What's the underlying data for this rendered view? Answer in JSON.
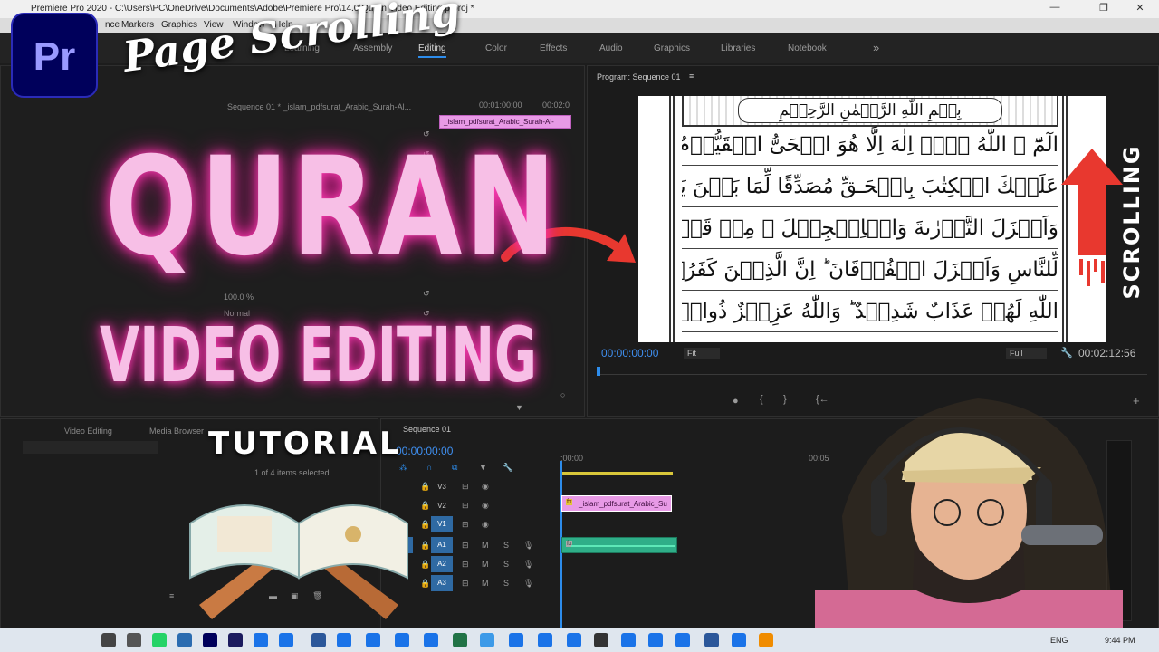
{
  "titlebar": {
    "title": "Premiere Pro 2020 - C:\\Users\\PC\\OneDrive\\Documents\\Adobe\\Premiere Pro\\14.0\\Quran Video Editing.prproj *",
    "minimize": "—",
    "maximize": "❐",
    "close": "✕"
  },
  "menubar": {
    "items": [
      "nce",
      "Markers",
      "Graphics",
      "View",
      "Window",
      "Help"
    ]
  },
  "workspaces": {
    "tabs": [
      "Learning",
      "Assembly",
      "Editing",
      "Color",
      "Effects",
      "Audio",
      "Graphics",
      "Libraries",
      "Notebook"
    ],
    "more": "»"
  },
  "source_panel": {
    "clip_name": "_islam_pdfsurat_Arabic_Surah-Al-",
    "sequence_label": "Sequence 01 * _islam_pdfsurat_Arabic_Surah-Al...",
    "time_1": "00:01:00:00",
    "time_2": "00:02:0",
    "opacity_value": "100.0 %",
    "blend_mode": "Normal"
  },
  "program": {
    "title": "Program: Sequence 01",
    "menu_icon": "≡",
    "current_time": "00:00:00:00",
    "fit": "Fit",
    "quality": "Full",
    "duration": "00:02:12:56"
  },
  "quran_page": {
    "header": "بِسۡمِ اللّٰهِ الرَّحۡمٰنِ الرَّحِيۡمِ",
    "lines": [
      "الٓمّٓ ۚ اللّٰهُ لَاۤ اِلٰهَ اِلَّا هُوَ الۡحَىُّ الۡقَيُّوۡمُ ؕ نَزَّلَ",
      "عَلَيۡكَ الۡكِتٰبَ بِالۡحَـقِّ مُصَدِّقًا لِّمَا بَيۡنَ يَدَيۡهِ",
      "وَاَنۡزَلَ التَّوۡرٰٮةَ وَالۡاِنۡجِيۡلَ ۙ مِنۡ قَبۡلُ هُدًى",
      "لِّلنَّاسِ وَاَنۡزَلَ الۡفُرۡقَانَ ؕ اِنَّ الَّذِيۡنَ كَفَرُوۡا بِاٰيٰتِ",
      "اللّٰهِ لَهُمۡ عَذَابٌ شَدِيۡدٌ ‌ؕ وَاللّٰهُ عَزِيۡزٌ ذُوانۡتِقَامٍ"
    ]
  },
  "project_panel": {
    "tab": "Video Editing",
    "media_browser": "Media Browser",
    "items_selected": "1 of 4 items selected"
  },
  "timeline": {
    "title": "Sequence 01",
    "timecode": "00:00:00:00",
    "ruler_start": ":00:00",
    "ruler_mark": "00:05",
    "tracks": [
      {
        "name": "V3",
        "patch": ""
      },
      {
        "name": "V2",
        "patch": ""
      },
      {
        "name": "V1",
        "patch": "V1"
      },
      {
        "name": "A1",
        "patch": "A1"
      },
      {
        "name": "A2",
        "patch": ""
      },
      {
        "name": "A3",
        "patch": ""
      }
    ],
    "clip_label": "_islam_pdfsurat_Arabic_Su",
    "fx_badge": "fx",
    "mute": "M",
    "solo": "S"
  },
  "overlay": {
    "logo_text": "Pr",
    "script_title": "Page Scrolling",
    "main_title": "QURAN",
    "subtitle": "VIDEO EDITING",
    "tutorial": "TUTORIAL",
    "side_text": "SCROLLING"
  },
  "taskbar": {
    "language": "ENG",
    "time": "9:44 PM"
  },
  "colors": {
    "accent_blue": "#2d8ceb",
    "clip_pink": "#e89ae6",
    "audio_green": "#2fae88",
    "neon_pink": "#f7bfe6",
    "arrow_red": "#e8382f"
  }
}
